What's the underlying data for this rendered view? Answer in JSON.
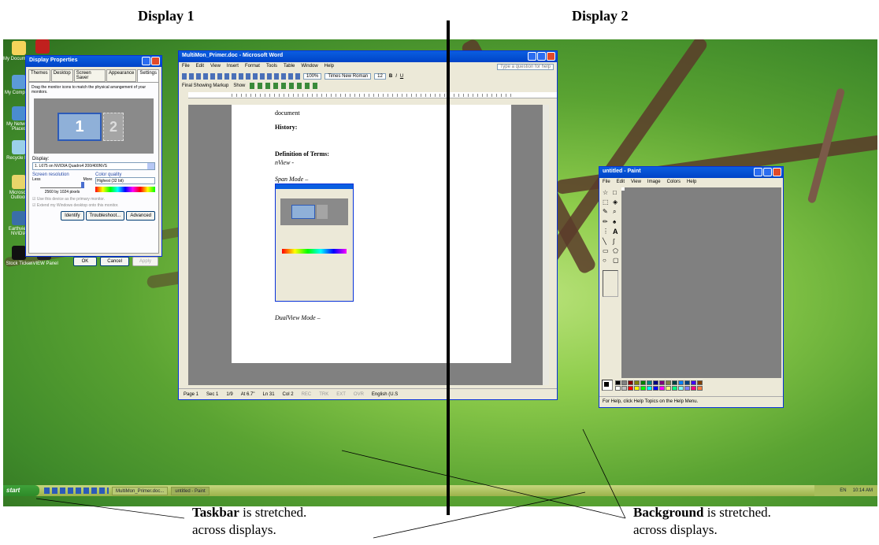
{
  "captions": {
    "display1": "Display 1",
    "display2": "Display 2"
  },
  "notes": {
    "taskbar_bold": "Taskbar",
    "taskbar_rest": " is stretched.",
    "taskbar_line2": "across displays.",
    "background_bold": "Background",
    "background_rest": " is stretched.",
    "background_line2": "across displays."
  },
  "display_props": {
    "title": "Display Properties",
    "tabs": [
      "Themes",
      "Desktop",
      "Screen Saver",
      "Appearance",
      "Settings"
    ],
    "instruction": "Drag the monitor icons to match the physical arrangement of your monitors.",
    "monitor1": "1",
    "monitor2": "2",
    "display_label": "Display:",
    "display_value": "1. L675 on NVIDIA Quadro4 200/400NVS",
    "resolution_label": "Screen resolution",
    "less": "Less",
    "more": "More",
    "resolution_value": "2560 by 1024 pixels",
    "color_label": "Color quality",
    "color_value": "Highest (32 bit)",
    "check1": "Use this device as the primary monitor.",
    "check2": "Extend my Windows desktop onto this monitor.",
    "identify": "Identify",
    "troubleshoot": "Troubleshoot...",
    "advanced": "Advanced",
    "ok": "OK",
    "cancel": "Cancel",
    "apply": "Apply"
  },
  "word": {
    "title": "MultiMon_Primer.doc - Microsoft Word",
    "menu": [
      "File",
      "Edit",
      "View",
      "Insert",
      "Format",
      "Tools",
      "Table",
      "Window",
      "Help"
    ],
    "help_box": "Type a question for help",
    "zoom": "100%",
    "font": "Times New Roman",
    "font_size": "12",
    "markup": "Final Showing Markup",
    "show": "Show",
    "doc_lines": [
      "document",
      "History:",
      "Definition of Terms:",
      "nView -",
      "Span Mode –",
      "DualView Mode –"
    ],
    "status": [
      "Page 1",
      "Sec 1",
      "1/9",
      "At 6.7\"",
      "Ln 31",
      "Col 2",
      "REC",
      "TRK",
      "EXT",
      "OVR",
      "English (U.S"
    ]
  },
  "paint": {
    "title": "untitled - Paint",
    "menu": [
      "File",
      "Edit",
      "View",
      "Image",
      "Colors",
      "Help"
    ],
    "status": "For Help, click Help Topics on the Help Menu.",
    "palette": [
      "#000000",
      "#808080",
      "#800000",
      "#808000",
      "#008000",
      "#008080",
      "#000080",
      "#800080",
      "#808040",
      "#004040",
      "#0080ff",
      "#004080",
      "#4000ff",
      "#804000",
      "#ffffff",
      "#c0c0c0",
      "#ff0000",
      "#ffff00",
      "#00ff00",
      "#00ffff",
      "#0000ff",
      "#ff00ff",
      "#ffff80",
      "#00ff80",
      "#80ffff",
      "#8080ff",
      "#ff0080",
      "#ff8040"
    ]
  },
  "desktop_icons": [
    "My Documents",
    "My Computer",
    "My Network Places",
    "Recycle Bin",
    "Microsoft Outlook",
    "Earthview NVIDIA",
    "Stock Ticker",
    "nVIEW Panel"
  ],
  "taskbar": {
    "start": "start",
    "item1": "MultiMon_Primer.doc...",
    "item2": "untitled - Paint",
    "lang": "EN",
    "time": "10:14 AM"
  }
}
